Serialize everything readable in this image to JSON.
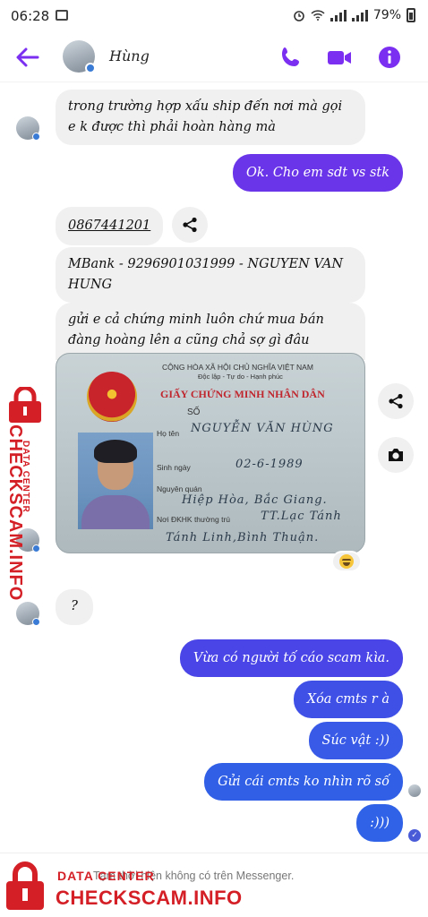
{
  "status_bar": {
    "time": "06:28",
    "battery": "79%"
  },
  "header": {
    "contact_name": "Hùng",
    "accent_color": "#7b2ff0",
    "icons": [
      "back-arrow-icon",
      "phone-icon",
      "video-camera-icon",
      "info-icon"
    ]
  },
  "messages": [
    {
      "id": "m1",
      "sender": "contact",
      "text_lines": [
        "trong trường hợp xấu ship đến nơi mà gọi",
        "e k được thì phải hoàn hàng mà"
      ]
    },
    {
      "id": "m2",
      "sender": "me",
      "text": "Ok. Cho em sdt vs stk"
    },
    {
      "id": "m3",
      "sender": "contact",
      "text": "0867441201"
    },
    {
      "id": "m4",
      "sender": "contact",
      "text_lines": [
        "MBank - 9296901031999 - NGUYEN VAN",
        "HUNG"
      ]
    },
    {
      "id": "m5",
      "sender": "contact",
      "text_lines": [
        "gửi e cả chứng minh luôn chứ mua bán",
        "đàng hoàng lên a cũng chả sợ gì đâu"
      ]
    },
    {
      "id": "m6",
      "sender": "contact",
      "text": "?"
    },
    {
      "id": "m7",
      "sender": "me",
      "text": "Vừa có người tố cáo scam kìa."
    },
    {
      "id": "m8",
      "sender": "me",
      "text": "Xóa cmts r à"
    },
    {
      "id": "m9",
      "sender": "me",
      "text": "Súc vật :))"
    },
    {
      "id": "m10",
      "sender": "me",
      "text": "Gửi cái cmts ko nhìn rõ số"
    },
    {
      "id": "m11",
      "sender": "me",
      "text": ":)))"
    }
  ],
  "id_card": {
    "header_line1": "CỘNG HÒA XÃ HỘI CHỦ NGHĨA VIỆT NAM",
    "header_line2": "Độc lập - Tự do - Hạnh phúc",
    "title": "GIẤY CHỨNG MINH NHÂN DÂN",
    "number_label": "SỐ",
    "name_label": "Họ tên",
    "name_value": "NGUYỄN VĂN HÙNG",
    "dob_label": "Sinh ngày",
    "dob_value": "02-6-1989",
    "origin_label": "Nguyên quán",
    "origin_value": "Hiệp Hòa, Bắc Giang.",
    "residence_label": "Nơi ĐKHK thường trú",
    "residence_value_1": "TT.Lạc Tánh",
    "residence_value_2": "Tánh Linh,Bình Thuận."
  },
  "reaction_emoji": "laughing-emoji",
  "colors": {
    "outgoing_gradient_top": "#6a35e8",
    "outgoing_gradient_bottom": "#2f5fe6",
    "incoming_bubble": "#f0f0f0",
    "watermark_red": "#d41f26"
  },
  "notice": {
    "text": "Tạm thời hiện không có trên Messenger."
  },
  "watermark": {
    "label": "DATA CENTER",
    "url": "CHECKSCAM.INFO"
  }
}
